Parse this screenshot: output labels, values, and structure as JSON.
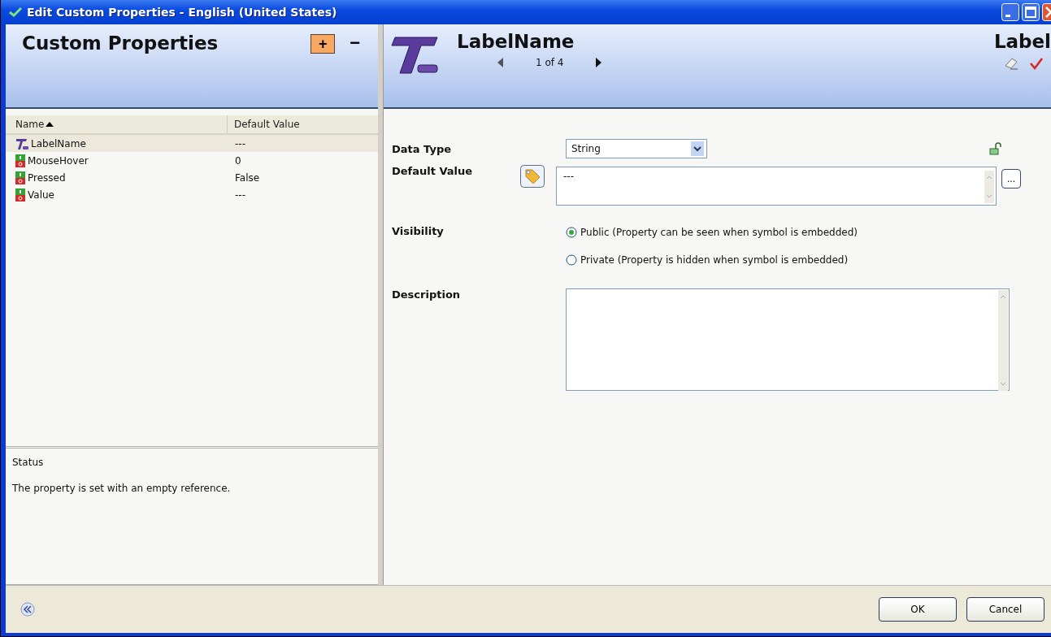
{
  "window": {
    "title": "Edit Custom Properties - English (United States)"
  },
  "left_panel": {
    "title": "Custom Properties",
    "add_button": "+",
    "remove_button": "−"
  },
  "table": {
    "columns": [
      {
        "label": "Name",
        "sorted": true
      },
      {
        "label": "Default Value",
        "sorted": false
      }
    ],
    "rows": [
      {
        "kind": "label",
        "name": "LabelName",
        "default": "---",
        "selected": true
      },
      {
        "kind": "toggle",
        "name": "MouseHover",
        "default": "0",
        "selected": false
      },
      {
        "kind": "toggle",
        "name": "Pressed",
        "default": "False",
        "selected": false
      },
      {
        "kind": "toggle",
        "name": "Value",
        "default": "---",
        "selected": false
      }
    ]
  },
  "status": {
    "title": "Status",
    "message": "The property is set with an empty reference."
  },
  "detail": {
    "title": "LabelName",
    "pager": "1 of 4",
    "type_label": "Label",
    "fields": {
      "data_type_label": "Data Type",
      "data_type_value": "String",
      "default_value_label": "Default Value",
      "default_value": "---",
      "ellipsis_button": "...",
      "visibility_label": "Visibility",
      "description_label": "Description"
    },
    "visibility_options": [
      {
        "label": "Public (Property can be seen when symbol is embedded)",
        "selected": true
      },
      {
        "label": "Private (Property is hidden when symbol is embedded)",
        "selected": false
      }
    ]
  },
  "buttons": [
    "OK",
    "Cancel"
  ]
}
